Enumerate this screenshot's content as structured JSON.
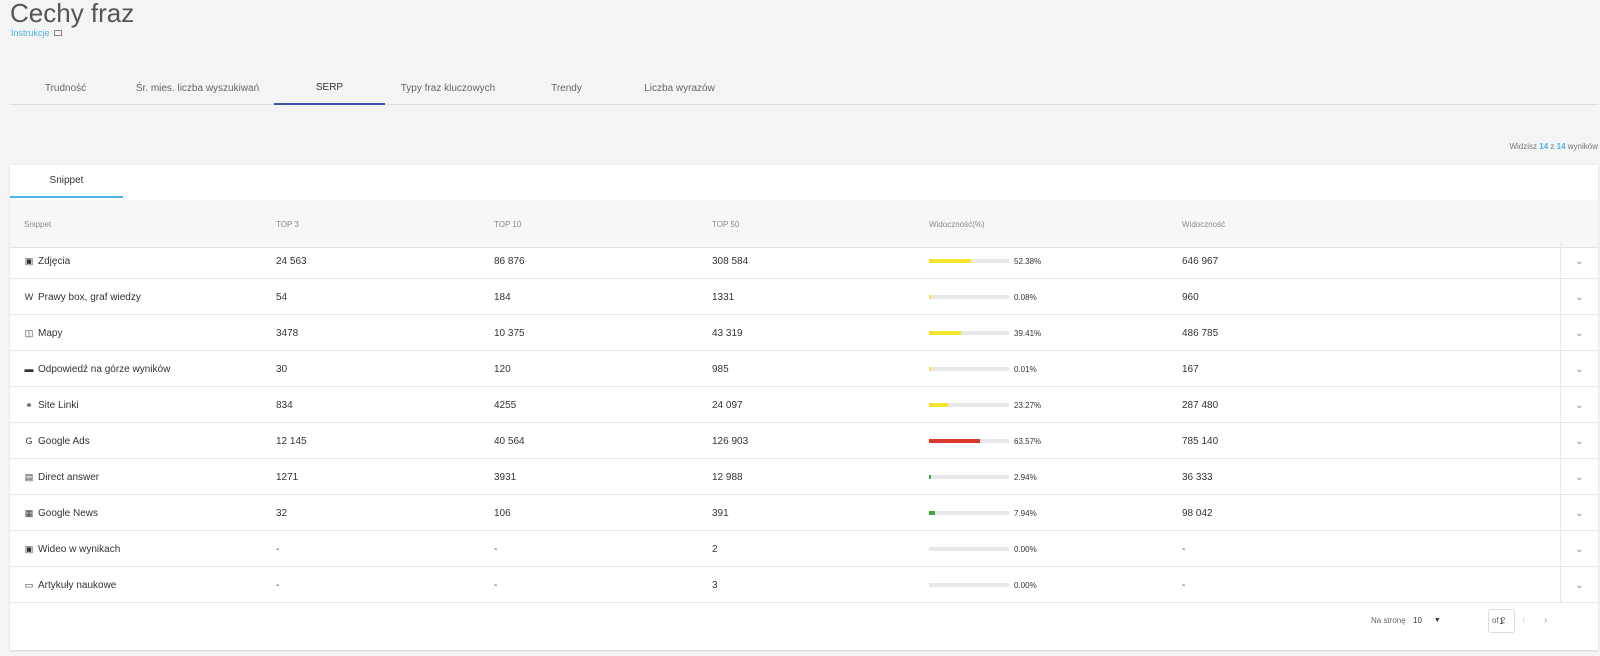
{
  "title": "Cechy fraz",
  "instructions_link": "Instrukcje",
  "tabs": [
    "Trudność",
    "Śr. mies. liczba wyszukiwań",
    "SERP",
    "Typy fraz kluczowych",
    "Trendy",
    "Liczba wyrazów"
  ],
  "active_tab": "SERP",
  "counter": {
    "prefix": "Widzisz",
    "shown": "14",
    "middle": "z",
    "total": "14",
    "suffix": "wyników"
  },
  "subtab": "Snippet",
  "columns": [
    "Snippet",
    "TOP 3",
    "TOP 10",
    "TOP 50",
    "Widoczność(%)",
    "Widoczność"
  ],
  "colors": {
    "accent": "#4ab3e8",
    "tab_indicator": "#3f51b5",
    "yellow": "#f5e52a",
    "red": "#d9382c",
    "green": "#3dab3d"
  },
  "rows": [
    {
      "icon": "image-icon",
      "glyph": "▣",
      "name": "Zdjęcia",
      "top3": "24 563",
      "top10": "86 876",
      "top50": "308 584",
      "pct_label": "52.38%",
      "pct": 52.38,
      "bar_color": "#f5e52a",
      "vis": "646 967"
    },
    {
      "icon": "wikipedia-icon",
      "glyph": "W",
      "name": "Prawy box, graf wiedzy",
      "top3": "54",
      "top10": "184",
      "top50": "1331",
      "pct_label": "0.08%",
      "pct": 0.08,
      "bar_color": "#f5e52a",
      "vis": "960"
    },
    {
      "icon": "map-icon",
      "glyph": "◫",
      "name": "Mapy",
      "top3": "3478",
      "top10": "10 375",
      "top50": "43 319",
      "pct_label": "39.41%",
      "pct": 39.41,
      "bar_color": "#f5e52a",
      "vis": "486 785"
    },
    {
      "icon": "answer-icon",
      "glyph": "▬",
      "name": "Odpowiedź na górze wyników",
      "top3": "30",
      "top10": "120",
      "top50": "985",
      "pct_label": "0.01%",
      "pct": 0.01,
      "bar_color": "#f5e52a",
      "vis": "167"
    },
    {
      "icon": "link-icon",
      "glyph": "⚭",
      "name": "Site Linki",
      "top3": "834",
      "top10": "4255",
      "top50": "24 097",
      "pct_label": "23.27%",
      "pct": 23.27,
      "bar_color": "#f5e52a",
      "vis": "287 480"
    },
    {
      "icon": "google-icon",
      "glyph": "G",
      "name": "Google Ads",
      "top3": "12 145",
      "top10": "40 564",
      "top50": "126 903",
      "pct_label": "63.57%",
      "pct": 63.57,
      "bar_color": "#d9382c",
      "vis": "785 140"
    },
    {
      "icon": "direct-answer-icon",
      "glyph": "▤",
      "name": "Direct answer",
      "top3": "1271",
      "top10": "3931",
      "top50": "12 988",
      "pct_label": "2.94%",
      "pct": 2.94,
      "bar_color": "#3dab3d",
      "vis": "36 333"
    },
    {
      "icon": "news-icon",
      "glyph": "▦",
      "name": "Google News",
      "top3": "32",
      "top10": "106",
      "top50": "391",
      "pct_label": "7.94%",
      "pct": 7.94,
      "bar_color": "#3dab3d",
      "vis": "98 042"
    },
    {
      "icon": "video-icon",
      "glyph": "▣",
      "name": "Wideo w wynikach",
      "top3": "-",
      "top10": "-",
      "top50": "2",
      "pct_label": "0.00%",
      "pct": 0,
      "bar_color": "#f5e52a",
      "vis": "-"
    },
    {
      "icon": "scholar-icon",
      "glyph": "▭",
      "name": "Artykuły naukowe",
      "top3": "-",
      "top10": "-",
      "top50": "3",
      "pct_label": "0.00%",
      "pct": 0,
      "bar_color": "#f5e52a",
      "vis": "-"
    }
  ],
  "footer": {
    "per_page_label": "Na stronę",
    "per_page": "10",
    "page": "1",
    "of_pages": "of 2"
  }
}
